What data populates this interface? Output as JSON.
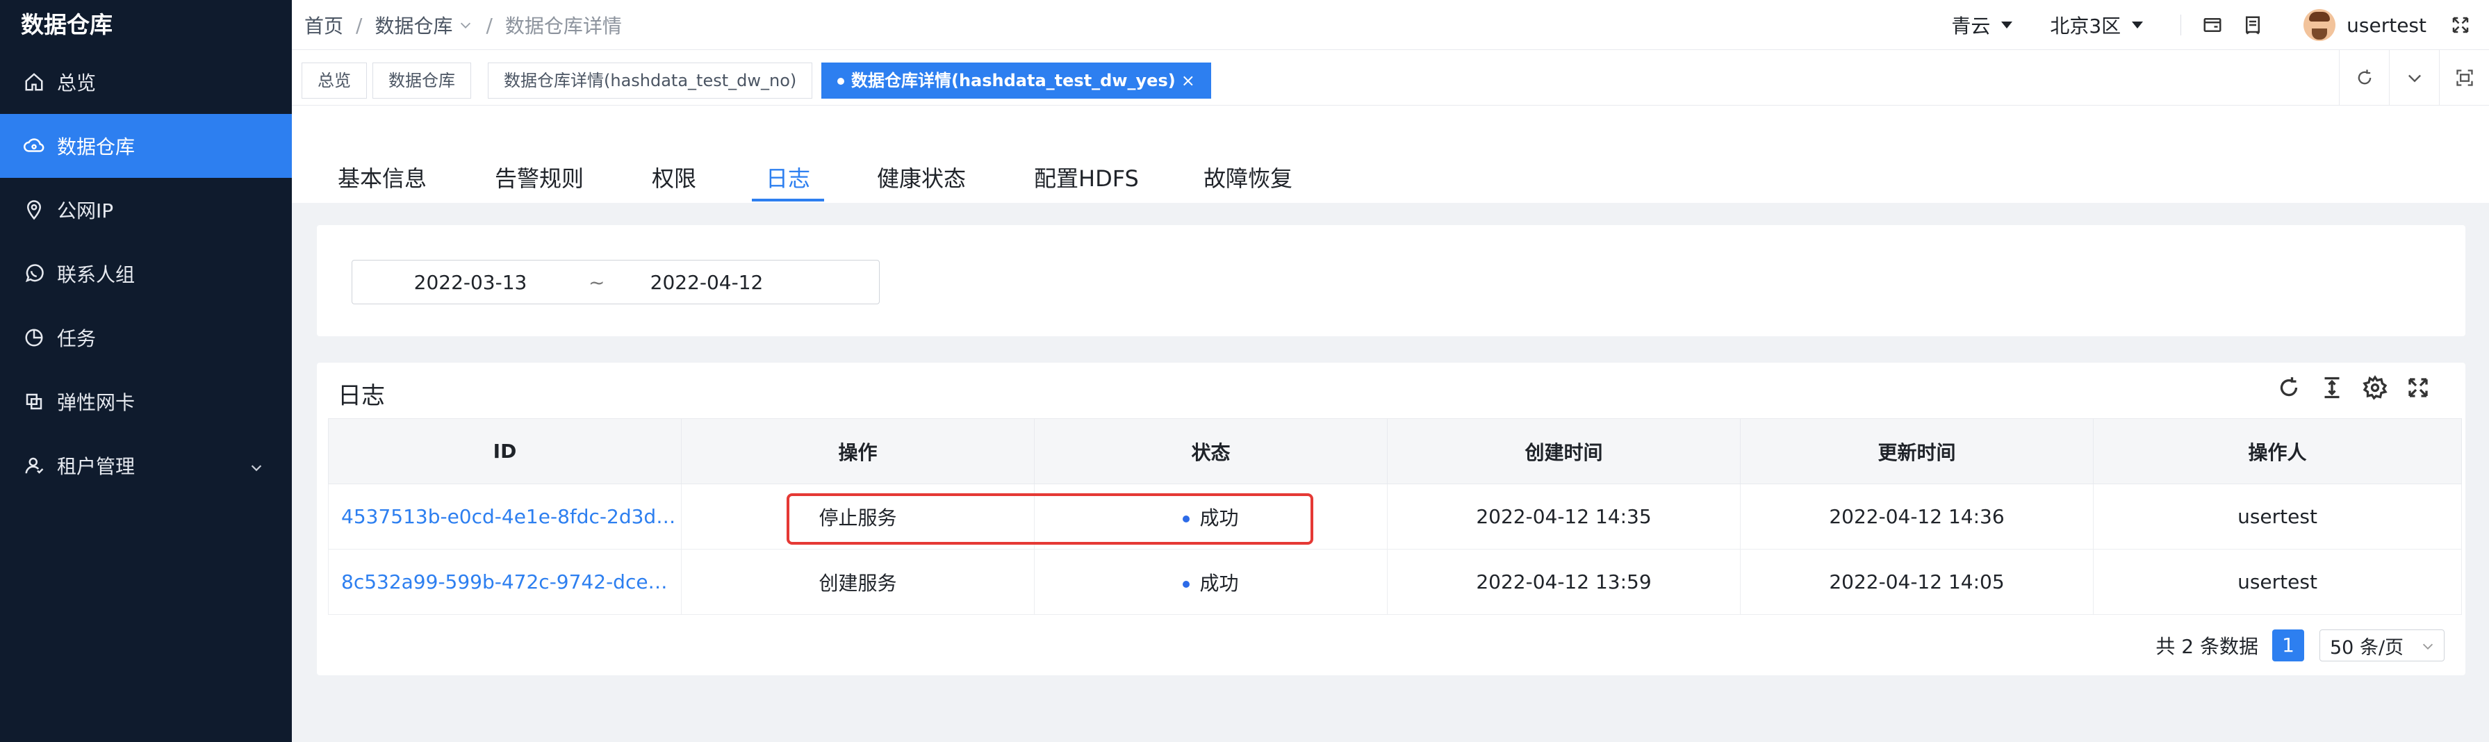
{
  "sidebar": {
    "brand": "数据仓库",
    "items": [
      {
        "label": "总览"
      },
      {
        "label": "数据仓库"
      },
      {
        "label": "公网IP"
      },
      {
        "label": "联系人组"
      },
      {
        "label": "任务"
      },
      {
        "label": "弹性网卡"
      },
      {
        "label": "租户管理"
      }
    ]
  },
  "header": {
    "breadcrumb": [
      "首页",
      "数据仓库",
      "数据仓库详情"
    ],
    "separator": "/",
    "zone1": "青云",
    "zone2": "北京3区",
    "username": "usertest"
  },
  "page_tabs": [
    {
      "label": "总览"
    },
    {
      "label": "数据仓库"
    },
    {
      "label": "数据仓库详情(hashdata_test_dw_no)"
    },
    {
      "label": "数据仓库详情(hashdata_test_dw_yes)",
      "close": "×"
    }
  ],
  "detail_tabs": [
    "基本信息",
    "告警规则",
    "权限",
    "日志",
    "健康状态",
    "配置HDFS",
    "故障恢复"
  ],
  "filter": {
    "start_date": "2022-03-13",
    "tilde": "~",
    "end_date": "2022-04-12"
  },
  "log": {
    "title": "日志",
    "columns": [
      "ID",
      "操作",
      "状态",
      "创建时间",
      "更新时间",
      "操作人"
    ],
    "rows": [
      {
        "id": "4537513b-e0cd-4e1e-8fdc-2d3d9…",
        "op": "停止服务",
        "status": "成功",
        "created": "2022-04-12 14:35",
        "updated": "2022-04-12 14:36",
        "user": "usertest"
      },
      {
        "id": "8c532a99-599b-472c-9742-dce…",
        "op": "创建服务",
        "status": "成功",
        "created": "2022-04-12 13:59",
        "updated": "2022-04-12 14:05",
        "user": "usertest"
      }
    ],
    "total_text": "共 2 条数据",
    "page": "1",
    "page_size": "50 条/页"
  },
  "colors": {
    "sidebar_bg": "#0f1b2d",
    "accent": "#2d7ff0",
    "highlight": "#e53935"
  }
}
